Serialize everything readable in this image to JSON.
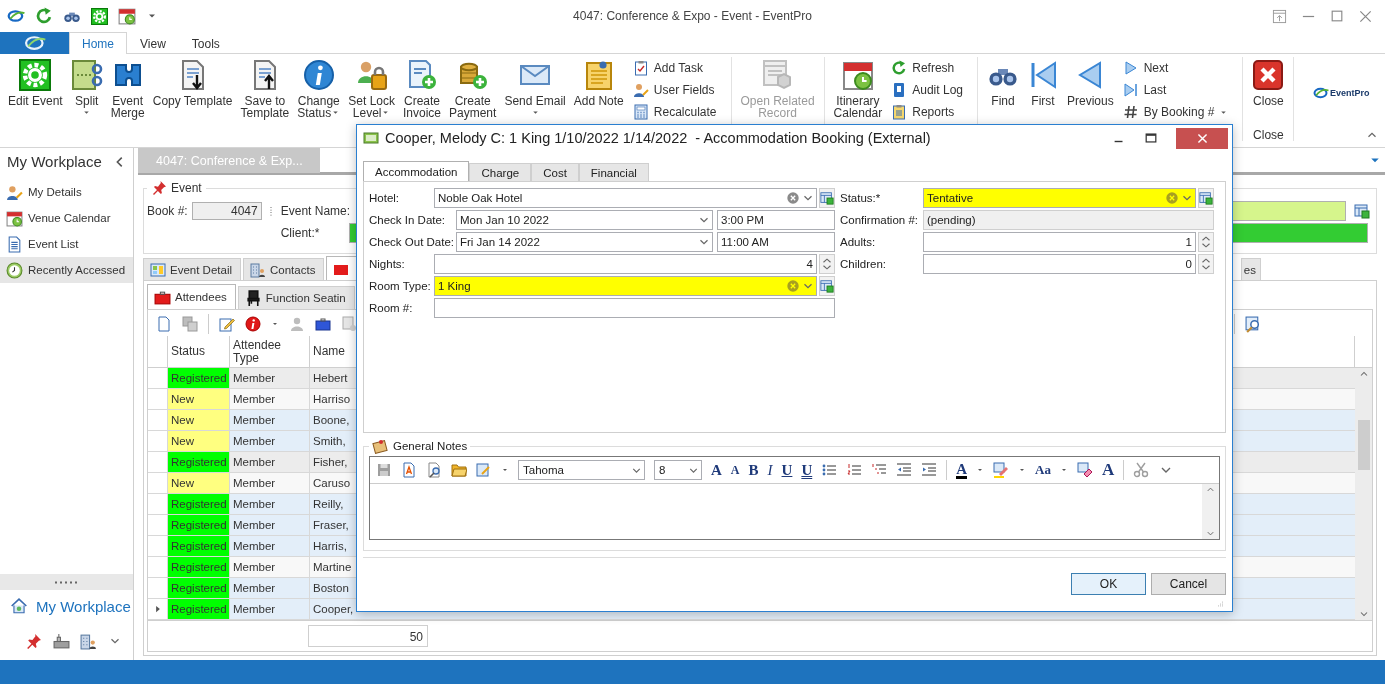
{
  "window": {
    "title": "4047: Conference & Expo - Event - EventPro"
  },
  "ribbon": {
    "tabs": [
      {
        "label": "Home",
        "selected": true
      },
      {
        "label": "View",
        "selected": false
      },
      {
        "label": "Tools",
        "selected": false
      }
    ],
    "items": [
      {
        "kind": "large",
        "label": "Edit Event",
        "dropdown": false,
        "disabled": false
      },
      {
        "kind": "large",
        "label": "Split",
        "dropdown": true,
        "disabled": false
      },
      {
        "kind": "large",
        "label": "Event\nMerge",
        "dropdown": false,
        "disabled": false
      },
      {
        "kind": "large",
        "label": "Copy Template",
        "dropdown": false,
        "disabled": false
      },
      {
        "kind": "large",
        "label": "Save to\nTemplate",
        "dropdown": false,
        "disabled": false
      },
      {
        "kind": "large",
        "label": "Change\nStatus",
        "dropdown": true,
        "disabled": false
      },
      {
        "kind": "large",
        "label": "Set Lock\nLevel",
        "dropdown": true,
        "disabled": false
      },
      {
        "kind": "large",
        "label": "Create\nInvoice",
        "dropdown": false,
        "disabled": false
      },
      {
        "kind": "large",
        "label": "Create\nPayment",
        "dropdown": false,
        "disabled": false
      },
      {
        "kind": "large",
        "label": "Send Email",
        "dropdown": true,
        "disabled": false
      },
      {
        "kind": "large",
        "label": "Add Note",
        "dropdown": false,
        "disabled": false
      },
      {
        "kind": "stack",
        "entries": [
          {
            "label": "Add Task",
            "dropdown": false
          },
          {
            "label": "User Fields",
            "dropdown": false
          },
          {
            "label": "Recalculate",
            "dropdown": false
          }
        ]
      },
      {
        "kind": "separator"
      },
      {
        "kind": "large",
        "label": "Open Related\nRecord",
        "dropdown": false,
        "disabled": true
      },
      {
        "kind": "separator"
      },
      {
        "kind": "large",
        "label": "Itinerary\nCalendar",
        "dropdown": false,
        "disabled": false
      },
      {
        "kind": "stack",
        "entries": [
          {
            "label": "Refresh",
            "dropdown": false
          },
          {
            "label": "Audit Log",
            "dropdown": false
          },
          {
            "label": "Reports",
            "dropdown": false
          }
        ]
      },
      {
        "kind": "separator"
      },
      {
        "kind": "large",
        "label": "Find",
        "dropdown": false,
        "disabled": false
      },
      {
        "kind": "large",
        "label": "First",
        "dropdown": false,
        "disabled": false
      },
      {
        "kind": "large",
        "label": "Previous",
        "dropdown": false,
        "disabled": false
      },
      {
        "kind": "stack",
        "entries": [
          {
            "label": "Next",
            "dropdown": false
          },
          {
            "label": "Last",
            "dropdown": false
          },
          {
            "label": "By Booking #",
            "dropdown": true
          }
        ]
      },
      {
        "kind": "separator"
      },
      {
        "kind": "large",
        "label": "Close",
        "dropdown": false,
        "disabled": false,
        "group_label": "Close"
      },
      {
        "kind": "separator"
      },
      {
        "kind": "logo",
        "text": "EventPro"
      }
    ]
  },
  "sidebar": {
    "title": "My Workplace",
    "items": [
      {
        "label": "My Details",
        "selected": false
      },
      {
        "label": "Venue Calendar",
        "selected": false
      },
      {
        "label": "Event List",
        "selected": false
      },
      {
        "label": "Recently Accessed",
        "selected": true
      }
    ],
    "footer_title": "My Workplace"
  },
  "document": {
    "tab_title": "4047: Conference & Exp...",
    "event": {
      "legend": "Event",
      "book_label": "Book #:",
      "book_value": "4047",
      "name_label": "Event Name:",
      "client_label": "Client:*"
    },
    "tabs": [
      {
        "label": "Event Detail",
        "selected": false
      },
      {
        "label": "Contacts",
        "selected": false
      },
      {
        "selected": true
      },
      {
        "label": "es",
        "selected": false
      }
    ],
    "subtabs": [
      {
        "label": "Attendees",
        "selected": true
      },
      {
        "label": "Function Seatin",
        "selected": false
      }
    ],
    "grid": {
      "columns": [
        "Status",
        "Attendee\nType",
        "Name"
      ],
      "rows": [
        {
          "status": "Registered",
          "color": "#00ff00",
          "type": "Member",
          "name": "Hebert",
          "highlighted": false,
          "current": false
        },
        {
          "status": "New",
          "color": "#ffff80",
          "type": "Member",
          "name": "Harriso",
          "highlighted": false,
          "current": false
        },
        {
          "status": "New",
          "color": "#ffff80",
          "type": "Member",
          "name": "Boone,",
          "highlighted": true,
          "current": false
        },
        {
          "status": "New",
          "color": "#ffff80",
          "type": "Member",
          "name": "Smith,",
          "highlighted": true,
          "current": false
        },
        {
          "status": "Registered",
          "color": "#00ff00",
          "type": "Member",
          "name": "Fisher,",
          "highlighted": false,
          "current": false
        },
        {
          "status": "New",
          "color": "#ffff80",
          "type": "Member",
          "name": "Caruso",
          "highlighted": false,
          "current": false
        },
        {
          "status": "Registered",
          "color": "#00ff00",
          "type": "Member",
          "name": "Reilly,",
          "highlighted": true,
          "current": false
        },
        {
          "status": "Registered",
          "color": "#00ff00",
          "type": "Member",
          "name": "Fraser,",
          "highlighted": true,
          "current": false
        },
        {
          "status": "Registered",
          "color": "#00ff00",
          "type": "Member",
          "name": "Harris,",
          "highlighted": true,
          "current": false
        },
        {
          "status": "Registered",
          "color": "#00ff00",
          "type": "Member",
          "name": "Martine",
          "highlighted": false,
          "current": false
        },
        {
          "status": "Registered",
          "color": "#00ff00",
          "type": "Member",
          "name": "Boston",
          "highlighted": true,
          "current": false
        },
        {
          "status": "Registered",
          "color": "#00ff00",
          "type": "Member",
          "name": "Cooper,",
          "highlighted": true,
          "current": true
        }
      ],
      "footer": "50"
    }
  },
  "dialog": {
    "title": "Cooper, Melody C: 1 King 1/10/2022 1/14/2022  - Accommodation Booking (External)",
    "tabs": [
      {
        "label": "Accommodation",
        "selected": true
      },
      {
        "label": "Charge",
        "selected": false
      },
      {
        "label": "Cost",
        "selected": false
      },
      {
        "label": "Financial",
        "selected": false
      }
    ],
    "left_fields": [
      {
        "kind": "combo",
        "label": "Hotel:",
        "value": "Noble Oak Hotel",
        "highlighted": false
      },
      {
        "kind": "datetime",
        "label": "Check In Date:",
        "date": "Mon Jan 10 2022",
        "time": "3:00 PM"
      },
      {
        "kind": "datetime",
        "label": "Check Out Date:",
        "date": "Fri Jan 14 2022",
        "time": "11:00 AM"
      },
      {
        "kind": "spin",
        "label": "Nights:",
        "value": "4"
      },
      {
        "kind": "combo",
        "label": "Room Type:",
        "value": "1 King",
        "highlighted": true
      },
      {
        "kind": "text",
        "label": "Room #:"
      }
    ],
    "right_fields": [
      {
        "kind": "combo",
        "label": "Status:*",
        "value": "Tentative",
        "highlighted": true
      },
      {
        "kind": "readonly",
        "label": "Confirmation #:",
        "value": "(pending)"
      },
      {
        "kind": "spin",
        "label": "Adults:",
        "value": "1"
      },
      {
        "kind": "spin",
        "label": "Children:",
        "value": "0"
      }
    ],
    "notes": {
      "legend": "General Notes",
      "toolbar": [
        {
          "kind": "save"
        },
        {
          "kind": "style"
        },
        {
          "kind": "find"
        },
        {
          "kind": "open"
        },
        {
          "kind": "insert"
        },
        {
          "kind": "font",
          "value": "Tahoma"
        },
        {
          "kind": "size",
          "value": "8"
        },
        {
          "kind": "grow",
          "text": "A"
        },
        {
          "kind": "shrink",
          "text": "A"
        },
        {
          "kind": "bold",
          "text": "B"
        },
        {
          "kind": "italic",
          "text": "I"
        },
        {
          "kind": "underline",
          "text": "U"
        },
        {
          "kind": "double-underline",
          "text": "U"
        },
        {
          "kind": "bullets"
        },
        {
          "kind": "numbering"
        },
        {
          "kind": "multilevel"
        },
        {
          "kind": "outdent"
        },
        {
          "kind": "indent"
        },
        {
          "kind": "separator"
        },
        {
          "kind": "font-color",
          "text": "A"
        },
        {
          "kind": "highlight"
        },
        {
          "kind": "case",
          "text": "Aa"
        },
        {
          "kind": "clear-format"
        },
        {
          "kind": "font-dialog",
          "text": "A"
        },
        {
          "kind": "separator"
        },
        {
          "kind": "cut"
        },
        {
          "kind": "more"
        }
      ]
    },
    "buttons": [
      {
        "label": "OK",
        "focused": true
      },
      {
        "label": "Cancel",
        "focused": false
      }
    ]
  }
}
